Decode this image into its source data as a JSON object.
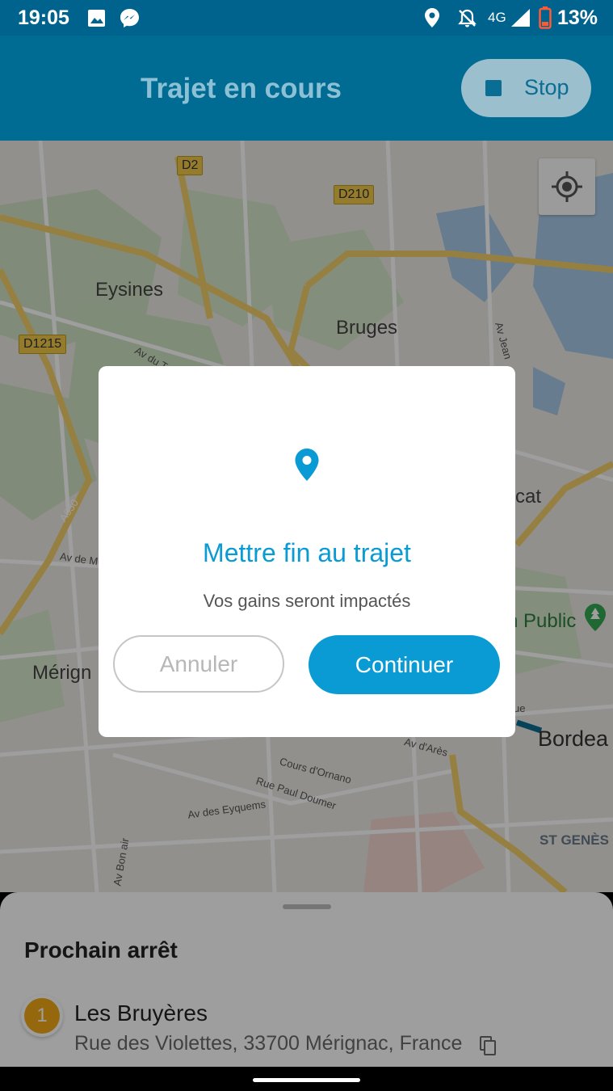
{
  "status_bar": {
    "time": "19:05",
    "network": "4G",
    "battery": "13%",
    "icons": [
      "image-icon",
      "messenger-icon",
      "location-icon",
      "alarm-off-icon",
      "signal-icon",
      "battery-low-icon"
    ]
  },
  "header": {
    "title": "Trajet en cours",
    "stop_label": "Stop"
  },
  "map": {
    "places": [
      "Eysines",
      "Bruges",
      "Mérign",
      "Bordea",
      "ST GENÈS",
      "cat",
      "n Public"
    ],
    "road_badges": [
      "D2",
      "D210",
      "D1215"
    ],
    "streets": [
      "Av du T",
      "A630",
      "Av de M",
      "Cours d'Ornano",
      "Rue Paul Doumer",
      "Av des Eyquems",
      "Av d'Arès",
      "Av Bon air",
      "Av Jean",
      "ue"
    ]
  },
  "bottom_sheet": {
    "title": "Prochain arrêt",
    "stop_number": "1",
    "stop_name": "Les Bruyères",
    "stop_address": "Rue des Violettes, 33700 Mérignac, France"
  },
  "dialog": {
    "title": "Mettre fin au trajet",
    "message": "Vos gains seront impactés",
    "cancel_label": "Annuler",
    "confirm_label": "Continuer"
  },
  "colors": {
    "primary": "#0a9bd4",
    "app_bar": "#006b93",
    "status_bar": "#00638e",
    "badge": "#f0a818"
  }
}
